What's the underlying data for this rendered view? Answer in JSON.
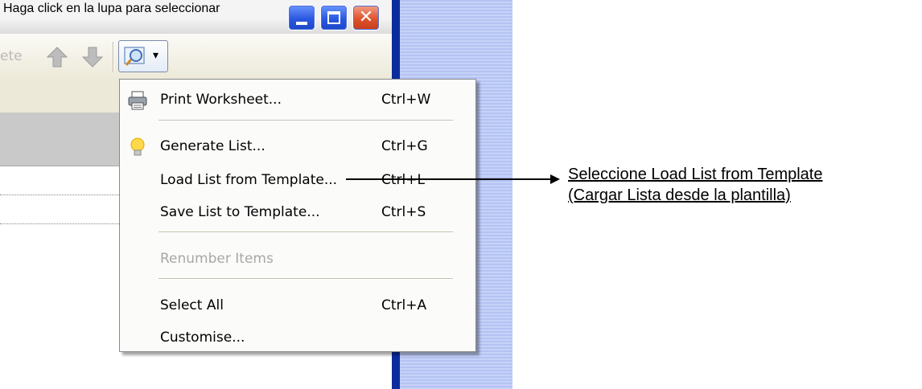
{
  "top_caption": "Haga click en la lupa para seleccionar",
  "window": {
    "title_buttons": {
      "minimize": "minimize-icon",
      "maximize": "maximize-icon",
      "close": "close-icon"
    },
    "close_glyph": "✕"
  },
  "toolbar": {
    "partial_label": "ete",
    "move_up_icon": "arrow-up-icon",
    "move_down_icon": "arrow-down-icon",
    "view_options_icon": "magnifier-icon",
    "dropdown_glyph": "▾"
  },
  "menu": {
    "items": [
      {
        "label": "Print Worksheet...",
        "shortcut": "Ctrl+W",
        "icon": "printer-icon",
        "enabled": true
      },
      {
        "label": "Generate List...",
        "shortcut": "Ctrl+G",
        "icon": "lightbulb-icon",
        "enabled": true
      },
      {
        "label": "Load List from Template...",
        "shortcut": "Ctrl+L",
        "enabled": true
      },
      {
        "label": "Save List to Template...",
        "shortcut": "Ctrl+S",
        "enabled": true
      },
      {
        "label": "Renumber Items",
        "shortcut": "",
        "enabled": false
      },
      {
        "label": "Select All",
        "shortcut": "Ctrl+A",
        "enabled": true
      },
      {
        "label": "Customise...",
        "shortcut": "",
        "enabled": true
      }
    ]
  },
  "callout": {
    "line1": "Seleccione Load List from Template",
    "line2": "(Cargar Lista desde la plantilla)"
  },
  "colors": {
    "xp_blue": "#2a58e0",
    "xp_close_red": "#e0532c",
    "menu_bg": "#fbfbf9",
    "disabled_text": "#a7a7a7"
  }
}
